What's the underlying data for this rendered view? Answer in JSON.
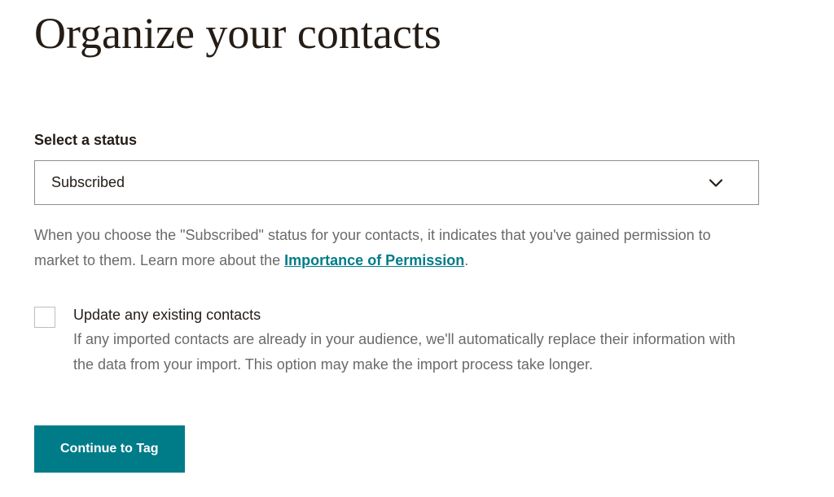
{
  "page": {
    "title": "Organize your contacts"
  },
  "status": {
    "label": "Select a status",
    "selected": "Subscribed",
    "help_prefix": "When you choose the \"Subscribed\" status for your contacts, it indicates that you've gained permission to market to them. Learn more about the ",
    "help_link_text": "Importance of Permission",
    "help_suffix": "."
  },
  "update_existing": {
    "label": "Update any existing contacts",
    "description": "If any imported contacts are already in your audience, we'll automatically replace their information with the data from your import. This option may make the import process take longer."
  },
  "actions": {
    "continue_label": "Continue to Tag"
  },
  "colors": {
    "accent": "#007c89"
  }
}
